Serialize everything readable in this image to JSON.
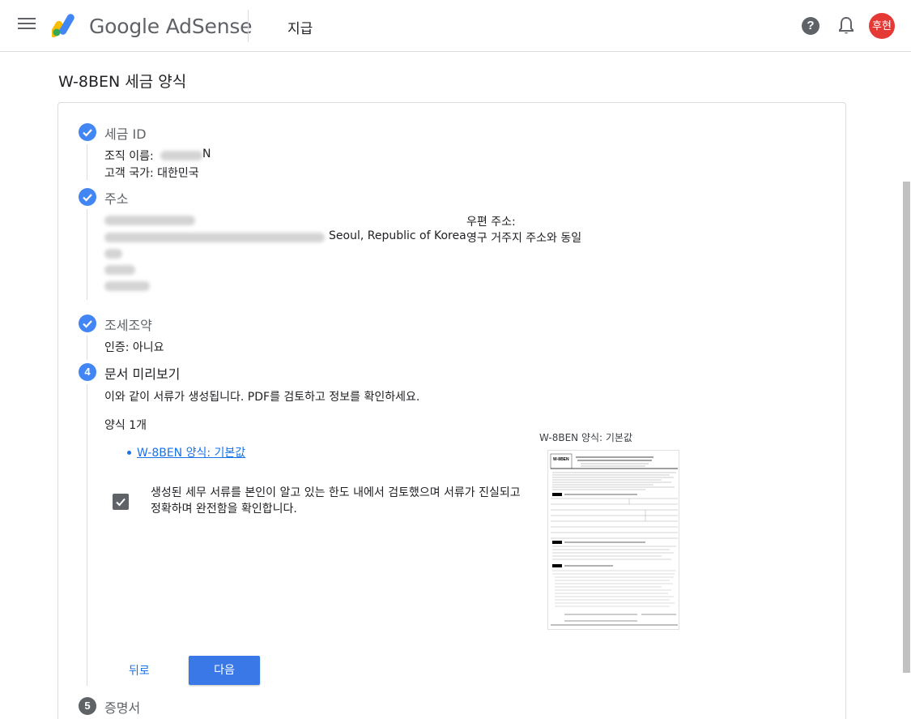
{
  "header": {
    "brand": "Google AdSense",
    "section": "지급",
    "help_glyph": "?",
    "avatar_text": "후현"
  },
  "page": {
    "title": "W-8BEN 세금 양식"
  },
  "steps": {
    "tax_id": {
      "number": "✓",
      "title": "세금 ID",
      "org_label": "조직 이름:",
      "org_suffix": "N",
      "country": "고객 국가: 대한민국"
    },
    "address": {
      "number": "✓",
      "title": "주소",
      "city_text": "Seoul, Republic of Korea",
      "postal_label": "우편 주소:",
      "postal_value": "영구 거주지 주소와 동일"
    },
    "treaty": {
      "number": "✓",
      "title": "조세조약",
      "certification": "인증: 아니요"
    },
    "preview": {
      "number": "4",
      "title": "문서 미리보기",
      "description": "이와 같이 서류가 생성됩니다. PDF를 검토하고 정보를 확인하세요.",
      "forms_count": "양식 1개",
      "form_link": "W-8BEN 양식: 기본값",
      "confirm_text": "생성된 세무 서류를 본인이 알고 있는 한도 내에서 검토했으며 서류가 진실되고 정확하며 완전함을 확인합니다.",
      "preview_label": "W-8BEN 양식: 기본값",
      "form_id": "W-8BEN",
      "form_heading": "Certificate of Foreign Status of Beneficial Owner for United States Tax Withholding and Reporting (Individuals)",
      "back_label": "뒤로",
      "next_label": "다음"
    },
    "certificate": {
      "number": "5",
      "title": "증명서"
    }
  },
  "colors": {
    "accent": "#4285f4",
    "button": "#3b78e7",
    "link": "#1a73e8"
  },
  "icons": [
    "menu-icon",
    "adsense-logo",
    "help-icon",
    "bell-icon",
    "check-icon"
  ]
}
